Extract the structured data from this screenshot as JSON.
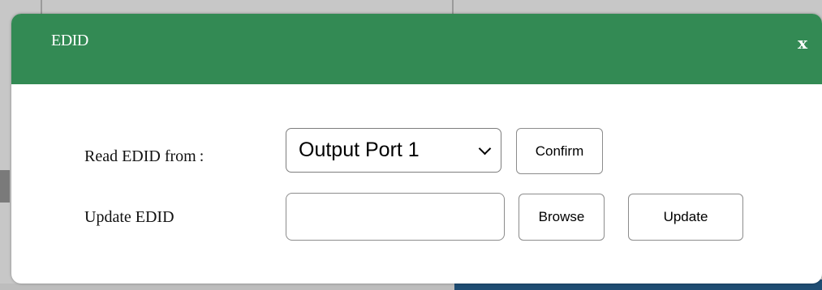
{
  "dialog": {
    "title": "EDID",
    "close_label": "x"
  },
  "read_row": {
    "label": "Read EDID from :",
    "selected_option": "Output Port 1",
    "confirm_label": "Confirm"
  },
  "update_row": {
    "label": "Update EDID",
    "file_value": "",
    "browse_label": "Browse",
    "update_label": "Update"
  },
  "colors": {
    "header_green": "#338a54",
    "overlay_gray": "#8f8f8f",
    "background_blue": "#1f4d73"
  }
}
